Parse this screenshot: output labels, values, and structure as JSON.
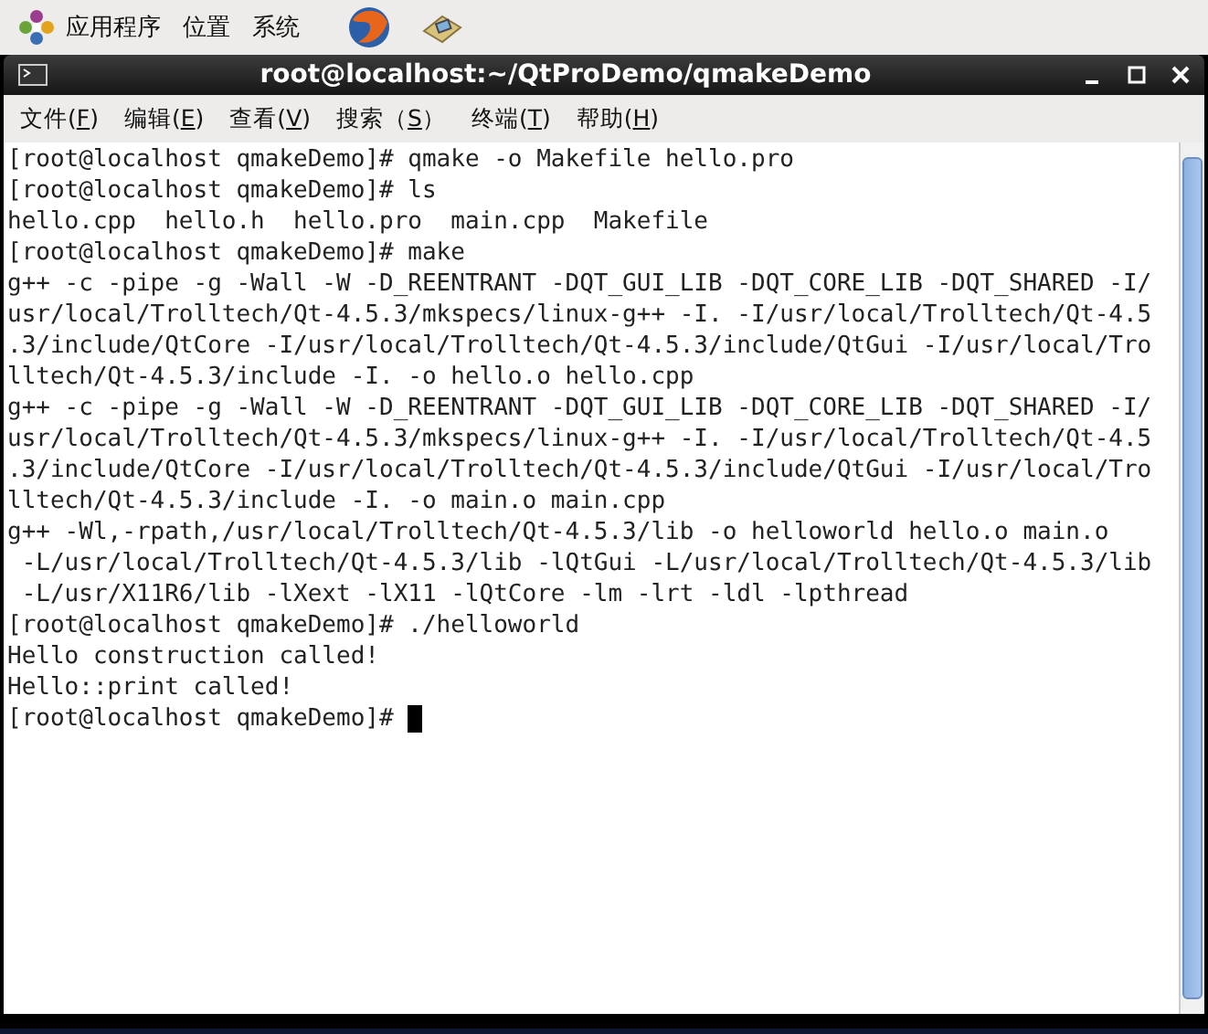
{
  "panel": {
    "menus": [
      "应用程序",
      "位置",
      "系统"
    ]
  },
  "window": {
    "title": "root@localhost:~/QtProDemo/qmakeDemo"
  },
  "menubar": [
    {
      "before": "文件(",
      "key": "F",
      "after": ")"
    },
    {
      "before": "编辑(",
      "key": "E",
      "after": ")"
    },
    {
      "before": "查看(",
      "key": "V",
      "after": ")"
    },
    {
      "before": "搜索（",
      "key": "S",
      "after": "）"
    },
    {
      "before": "终端(",
      "key": "T",
      "after": ")"
    },
    {
      "before": "帮助(",
      "key": "H",
      "after": ")"
    }
  ],
  "terminal": {
    "lines": [
      "[root@localhost qmakeDemo]# qmake -o Makefile hello.pro",
      "[root@localhost qmakeDemo]# ls",
      "hello.cpp  hello.h  hello.pro  main.cpp  Makefile",
      "[root@localhost qmakeDemo]# make",
      "g++ -c -pipe -g -Wall -W -D_REENTRANT -DQT_GUI_LIB -DQT_CORE_LIB -DQT_SHARED -I/",
      "usr/local/Trolltech/Qt-4.5.3/mkspecs/linux-g++ -I. -I/usr/local/Trolltech/Qt-4.5",
      ".3/include/QtCore -I/usr/local/Trolltech/Qt-4.5.3/include/QtGui -I/usr/local/Tro",
      "lltech/Qt-4.5.3/include -I. -o hello.o hello.cpp",
      "g++ -c -pipe -g -Wall -W -D_REENTRANT -DQT_GUI_LIB -DQT_CORE_LIB -DQT_SHARED -I/",
      "usr/local/Trolltech/Qt-4.5.3/mkspecs/linux-g++ -I. -I/usr/local/Trolltech/Qt-4.5",
      ".3/include/QtCore -I/usr/local/Trolltech/Qt-4.5.3/include/QtGui -I/usr/local/Tro",
      "lltech/Qt-4.5.3/include -I. -o main.o main.cpp",
      "g++ -Wl,-rpath,/usr/local/Trolltech/Qt-4.5.3/lib -o helloworld hello.o main.o",
      " -L/usr/local/Trolltech/Qt-4.5.3/lib -lQtGui -L/usr/local/Trolltech/Qt-4.5.3/lib",
      " -L/usr/X11R6/lib -lXext -lX11 -lQtCore -lm -lrt -ldl -lpthread",
      "[root@localhost qmakeDemo]# ./helloworld",
      "Hello construction called!",
      "Hello::print called!"
    ],
    "prompt": "[root@localhost qmakeDemo]# "
  }
}
